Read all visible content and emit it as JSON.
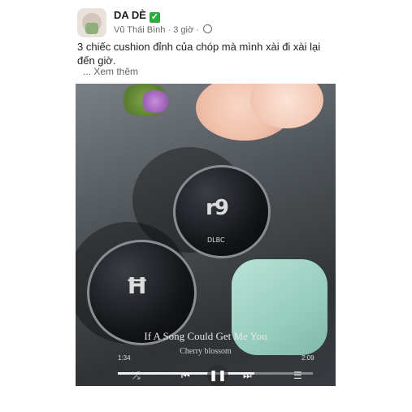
{
  "post": {
    "group_name": "DA DÈ",
    "verified_icon": "check-icon",
    "author": "Vũ Thái Bình",
    "time": "3 giờ",
    "privacy_icon": "globe-icon",
    "caption": "3 chiếc cushion đỉnh của chóp mà mình xài đi xài lại đến giờ.",
    "see_more": "... Xem thêm"
  },
  "media": {
    "song_title": "If A Song Could Get Me You",
    "song_artist": "Cherry blossom",
    "progress_fraction": 0.7,
    "elapsed": "1:34",
    "total": "2:09",
    "compact_labels": [
      "DLBC"
    ],
    "controls": [
      "shuffle-icon",
      "previous-icon",
      "pause-icon",
      "next-icon",
      "playlist-icon"
    ]
  }
}
